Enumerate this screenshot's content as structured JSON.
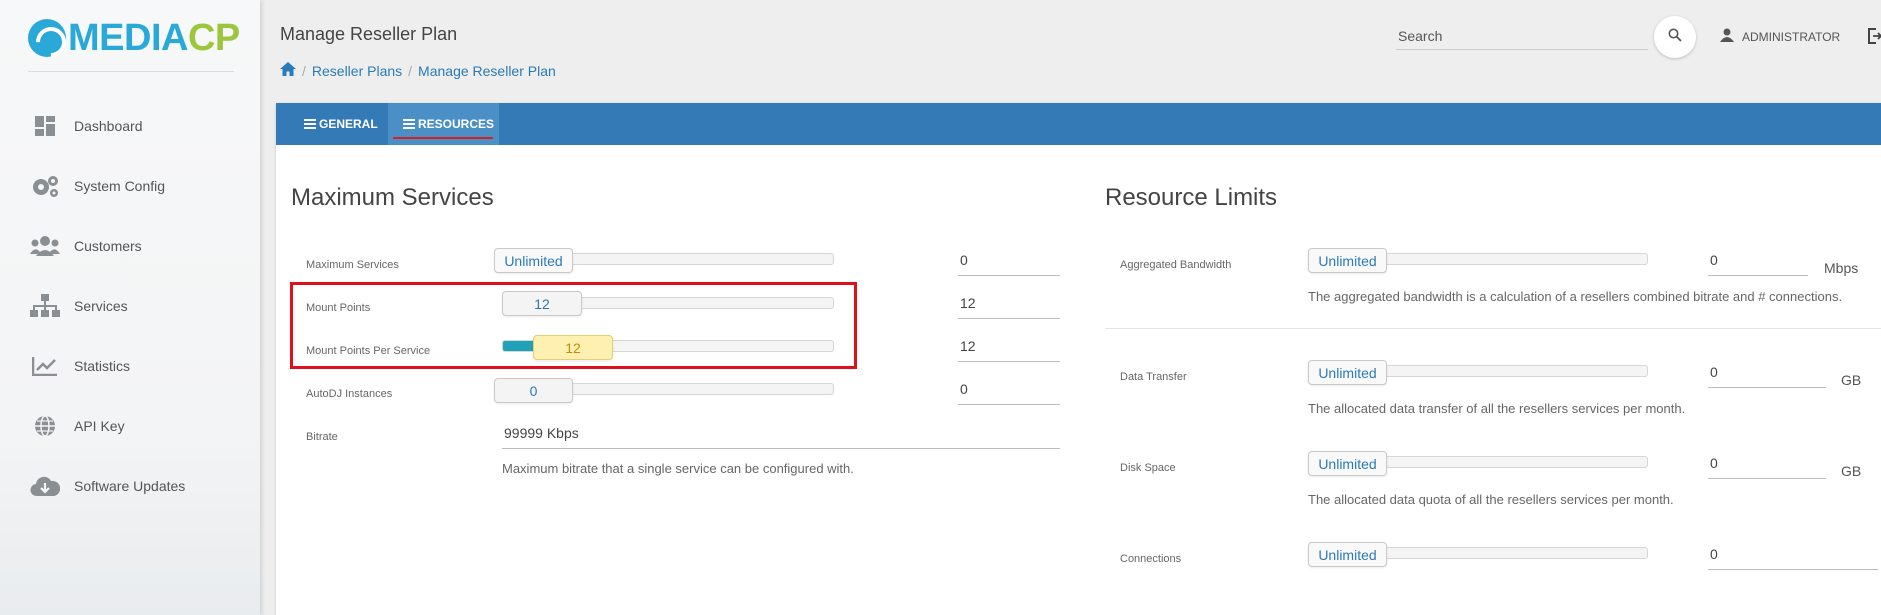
{
  "app": {
    "logo_part1": "MEDIA",
    "logo_part2": "CP",
    "brand_blue": "#2aa8d8",
    "brand_green": "#9cc63b"
  },
  "sidebar": {
    "items": [
      {
        "label": "Dashboard",
        "icon": "dashboard-icon"
      },
      {
        "label": "System Config",
        "icon": "gears-icon"
      },
      {
        "label": "Customers",
        "icon": "users-icon"
      },
      {
        "label": "Services",
        "icon": "sitemap-icon"
      },
      {
        "label": "Statistics",
        "icon": "chart-line-icon"
      },
      {
        "label": "API Key",
        "icon": "globe-icon"
      },
      {
        "label": "Software Updates",
        "icon": "cloud-download-icon"
      }
    ]
  },
  "header": {
    "title": "Manage Reseller Plan",
    "breadcrumb": [
      "Reseller Plans",
      "Manage Reseller Plan"
    ],
    "search_placeholder": "Search",
    "user_label": "ADMINISTRATOR"
  },
  "tabs": {
    "general": "GENERAL",
    "resources": "RESOURCES",
    "active": "RESOURCES"
  },
  "max_services": {
    "title": "Maximum Services",
    "rows": [
      {
        "label": "Maximum Services",
        "handle": "Unlimited",
        "value": "0",
        "level": 0
      },
      {
        "label": "Mount Points",
        "handle": "12",
        "value": "12",
        "level": 0.02
      },
      {
        "label": "Mount Points Per Service",
        "handle": "12",
        "value": "12",
        "level": 0.1
      },
      {
        "label": "AutoDJ Instances",
        "handle": "0",
        "value": "0",
        "level": 0
      }
    ],
    "bitrate": {
      "label": "Bitrate",
      "value": "99999 Kbps",
      "help": "Maximum bitrate that a single service can be configured with."
    }
  },
  "resource_limits": {
    "title": "Resource Limits",
    "rows": [
      {
        "label": "Aggregated Bandwidth",
        "handle": "Unlimited",
        "value": "0",
        "unit": "Mbps",
        "help": "The aggregated bandwidth is a calculation of a resellers combined bitrate and # connections."
      },
      {
        "label": "Data Transfer",
        "handle": "Unlimited",
        "value": "0",
        "unit": "GB",
        "help": "The allocated data transfer of all the resellers services per month."
      },
      {
        "label": "Disk Space",
        "handle": "Unlimited",
        "value": "0",
        "unit": "GB",
        "help": "The allocated data quota of all the resellers services per month."
      },
      {
        "label": "Connections",
        "handle": "Unlimited",
        "value": "0",
        "unit": "",
        "help": ""
      }
    ]
  },
  "colors": {
    "tabbar": "#337ab7",
    "link": "#2a7ab8",
    "highlight": "#e0101a",
    "slider_fill": "#1fa2b8"
  }
}
